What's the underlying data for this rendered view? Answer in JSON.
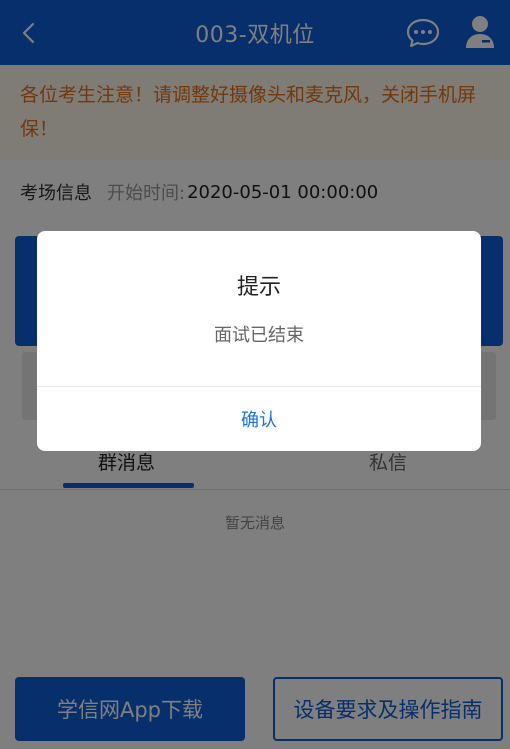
{
  "header": {
    "title": "003-双机位",
    "back_icon": "chevron-left-icon",
    "chat_icon": "chat-bubble-icon",
    "user_icon": "user-icon"
  },
  "notice": {
    "text": "各位考生注意！请调整好摄像头和麦克风，关闭手机屏保！"
  },
  "exam_info": {
    "label": "考场信息",
    "start_label": "开始时间:",
    "start_time": "2020-05-01 00:00:00"
  },
  "tabs": [
    {
      "label": "群消息",
      "active": true
    },
    {
      "label": "私信",
      "active": false
    }
  ],
  "messages": {
    "empty_text": "暂无消息"
  },
  "buttons": {
    "download_label": "学信网App下载",
    "guide_label": "设备要求及操作指南"
  },
  "dialog": {
    "title": "提示",
    "message": "面试已结束",
    "confirm_label": "确认"
  },
  "colors": {
    "primary": "#0f5fd6",
    "notice_text": "#e8701a",
    "notice_bg": "#fff6ea",
    "confirm_text": "#1a73d9"
  }
}
